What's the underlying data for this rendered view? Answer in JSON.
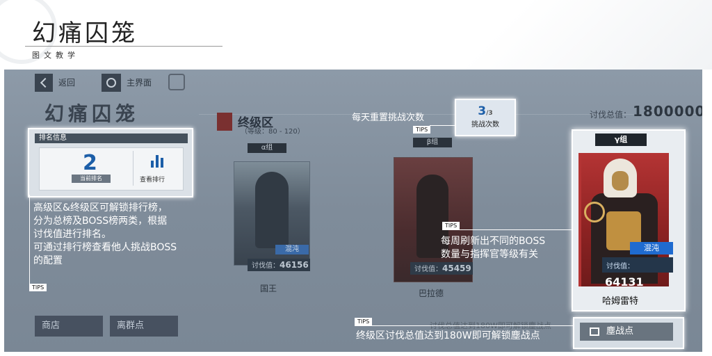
{
  "header": {
    "title": "幻痛囚笼",
    "subtitle": "图文教学"
  },
  "topbar": {
    "back": "返回",
    "home": "主界面"
  },
  "game_title": "幻痛囚笼",
  "zone": {
    "name": "终级区",
    "level": "（等级：80 - 120）"
  },
  "total": {
    "label": "讨伐总值：",
    "value": "1800000"
  },
  "rank": {
    "header": "排名信息",
    "number": "2",
    "current_label": "当前排名",
    "view_label": "查看排行"
  },
  "rank_desc": [
    "高级区&终级区可解锁排行榜，",
    "分为总榜及BOSS榜两类，根据",
    "讨伐值进行排名。",
    "可通过排行榜查看他人挑战BOSS",
    "的配置"
  ],
  "tips_label": "TIPS",
  "reset": {
    "text": "每天重置挑战次数",
    "count": "3",
    "total": "/3",
    "label": "挑战次数"
  },
  "groups": {
    "alpha": {
      "tag": "α组",
      "chaos": "混沌",
      "score_label": "讨伐值：",
      "score": "46156",
      "name": "国王"
    },
    "beta": {
      "tag": "β组",
      "score_label": "讨伐值：",
      "score": "45459",
      "name": "巴拉德"
    },
    "gamma": {
      "tag": "γ组",
      "chaos": "混沌",
      "score_label": "讨伐值：",
      "score": "64131",
      "name": "哈姆雷特"
    }
  },
  "boss_desc": [
    "每周刷新出不同的BOSS",
    "数量与指挥官等级有关"
  ],
  "bottom": {
    "shop": "商店",
    "leave": "离群点",
    "dust": "塵战点",
    "ghost": "讨伐总值达到180W即可解锁塵战点"
  },
  "dust_desc": "终级区讨伐总值达到180W即可解锁塵战点"
}
